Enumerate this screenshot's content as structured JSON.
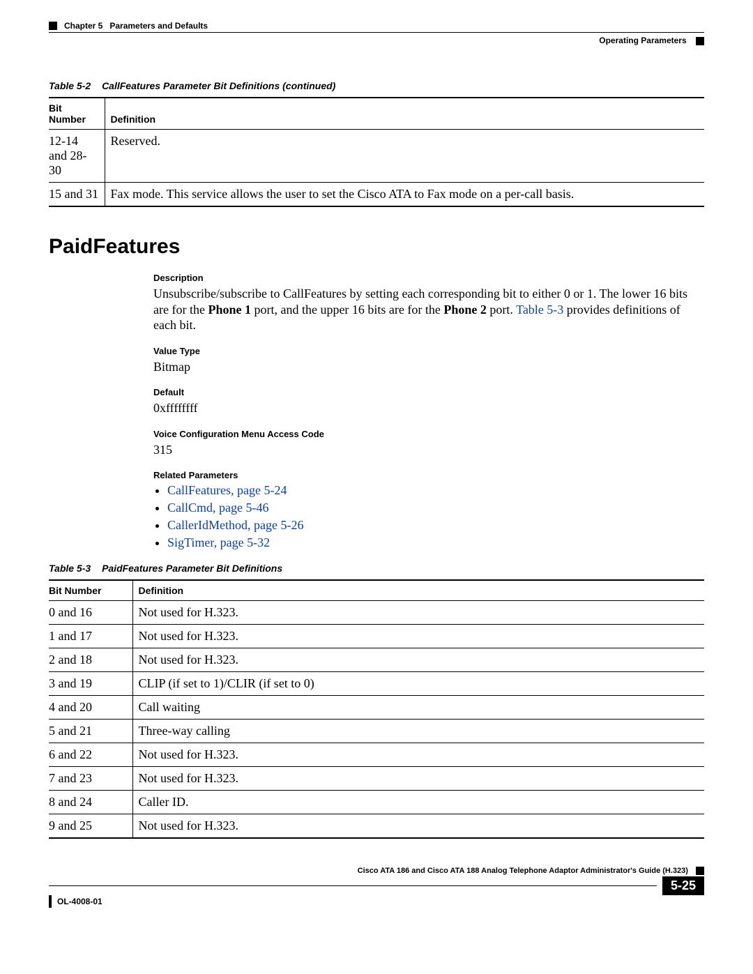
{
  "header": {
    "chapter_label": "Chapter 5",
    "chapter_title": "Parameters and Defaults",
    "sub": "Operating Parameters"
  },
  "table52": {
    "caption_label": "Table 5-2",
    "caption_title": "CallFeatures Parameter Bit Definitions (continued)",
    "col1": "Bit Number",
    "col2": "Definition",
    "rows": [
      {
        "bit": "12-14 and 28-30",
        "def": "Reserved."
      },
      {
        "bit": "15 and 31",
        "def": "Fax mode. This service allows the user to set the Cisco ATA to Fax mode on a per-call basis."
      }
    ]
  },
  "section_title": "PaidFeatures",
  "desc": {
    "label": "Description",
    "t1": "Unsubscribe/subscribe to CallFeatures by setting each corresponding bit to either 0 or 1. The lower 16 bits are for the ",
    "p1": "Phone 1",
    "t2": " port, and the upper 16 bits are for the ",
    "p2": "Phone 2",
    "t3": " port. ",
    "link": "Table 5-3",
    "t4": " provides definitions of each bit."
  },
  "vt": {
    "label": "Value Type",
    "value": "Bitmap"
  },
  "def": {
    "label": "Default",
    "value": "0xffffffff"
  },
  "vcm": {
    "label": "Voice Configuration Menu Access Code",
    "value": "315"
  },
  "rel": {
    "label": "Related Parameters",
    "items": [
      "CallFeatures, page 5-24",
      "CallCmd, page 5-46",
      "CallerIdMethod, page 5-26",
      "SigTimer, page 5-32"
    ]
  },
  "table53": {
    "caption_label": "Table 5-3",
    "caption_title": "PaidFeatures Parameter Bit Definitions",
    "col1": "Bit Number",
    "col2": "Definition",
    "rows": [
      {
        "bit": "0 and 16",
        "def": "Not used for H.323."
      },
      {
        "bit": "1 and 17",
        "def": "Not used for H.323."
      },
      {
        "bit": "2 and 18",
        "def": "Not used for H.323."
      },
      {
        "bit": "3 and 19",
        "def": "CLIP (if set to 1)/CLIR (if set to 0)"
      },
      {
        "bit": "4 and 20",
        "def": "Call waiting"
      },
      {
        "bit": "5 and 21",
        "def": "Three-way calling"
      },
      {
        "bit": "6 and 22",
        "def": "Not used for H.323."
      },
      {
        "bit": "7 and 23",
        "def": "Not used for H.323."
      },
      {
        "bit": "8 and 24",
        "def": "Caller ID."
      },
      {
        "bit": "9 and 25",
        "def": "Not used for H.323."
      }
    ]
  },
  "footer": {
    "guide": "Cisco ATA 186 and Cisco ATA 188 Analog Telephone Adaptor Administrator's Guide (H.323)",
    "doc": "OL-4008-01",
    "page": "5-25"
  }
}
